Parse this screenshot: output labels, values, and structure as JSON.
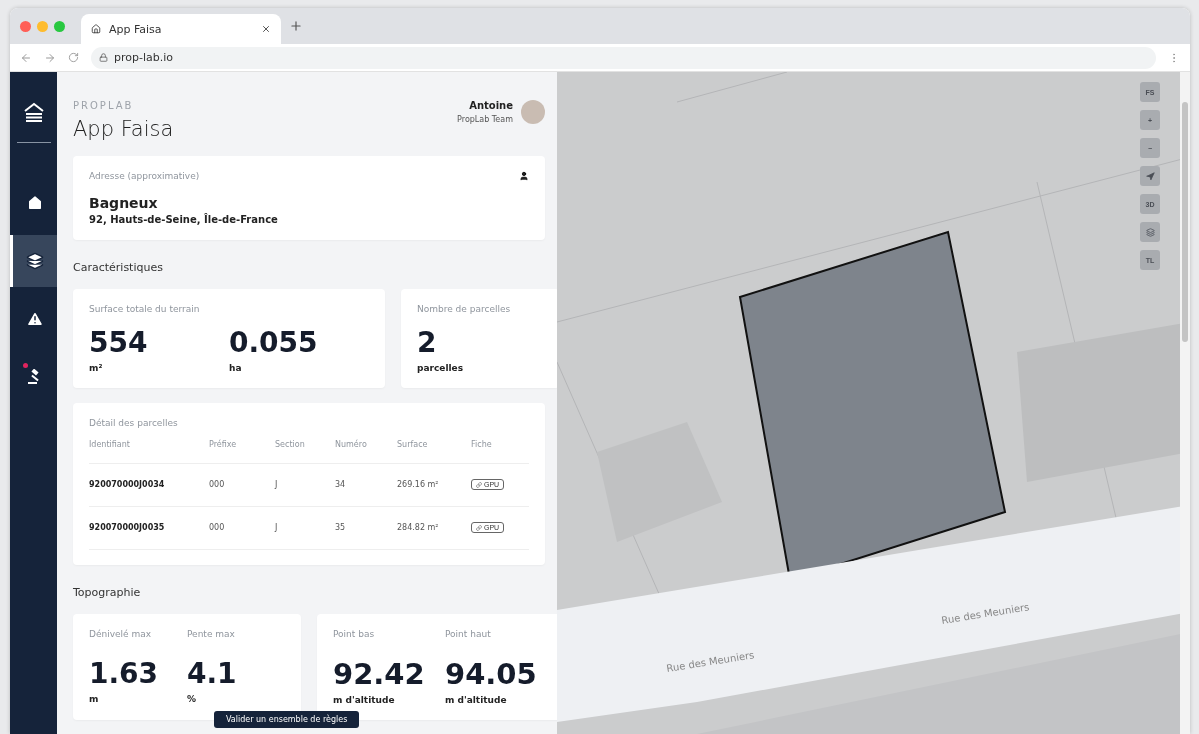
{
  "browser": {
    "tab_title": "App Faisa",
    "url": "prop-lab.io"
  },
  "sidebar": {
    "items": [
      {
        "selected": false,
        "badge": false
      },
      {
        "selected": true,
        "badge": false
      },
      {
        "selected": false,
        "badge": false
      },
      {
        "selected": false,
        "badge": true
      }
    ]
  },
  "header": {
    "brand": "PROPLAB",
    "title": "App Faisa",
    "user_name": "Antoine",
    "user_team": "PropLab Team"
  },
  "address": {
    "label": "Adresse (approximative)",
    "city": "Bagneux",
    "region": "92, Hauts-de-Seine, Île-de-France"
  },
  "sections": {
    "characteristics": "Caractéristiques",
    "topography": "Topographie"
  },
  "surface": {
    "label": "Surface totale du terrain",
    "values": [
      {
        "value": "554",
        "unit": "m²"
      },
      {
        "value": "0.055",
        "unit": "ha"
      }
    ]
  },
  "parcel_count": {
    "label": "Nombre de parcelles",
    "value": "2",
    "unit": "parcelles"
  },
  "parcels": {
    "title": "Détail des parcelles",
    "columns": [
      "Identifiant",
      "Préfixe",
      "Section",
      "Numéro",
      "Surface",
      "Fiche"
    ],
    "rows": [
      {
        "id": "920070000J0034",
        "prefix": "000",
        "section": "J",
        "number": "34",
        "surface": "269.16 m²",
        "link": "GPU"
      },
      {
        "id": "920070000J0035",
        "prefix": "000",
        "section": "J",
        "number": "35",
        "surface": "284.82 m²",
        "link": "GPU"
      }
    ]
  },
  "topo_cards": [
    [
      {
        "label": "Dénivelé max",
        "value": "1.63",
        "unit": "m"
      },
      {
        "label": "Pente max",
        "value": "4.1",
        "unit": "%"
      }
    ],
    [
      {
        "label": "Point bas",
        "value": "92.42",
        "unit": "m d'altitude"
      },
      {
        "label": "Point haut",
        "value": "94.05",
        "unit": "m d'altitude"
      }
    ]
  ],
  "tooltip": "Valider un ensemble de règles",
  "map": {
    "controls": [
      {
        "kind": "text",
        "label": "FS"
      },
      {
        "kind": "text",
        "label": "+"
      },
      {
        "kind": "text",
        "label": "−"
      },
      {
        "kind": "compass"
      },
      {
        "kind": "text",
        "label": "3D"
      },
      {
        "kind": "layers"
      },
      {
        "kind": "text",
        "label": "TL"
      }
    ],
    "streets": [
      "Rue des Meuniers",
      "Rue des Meuniers"
    ]
  }
}
